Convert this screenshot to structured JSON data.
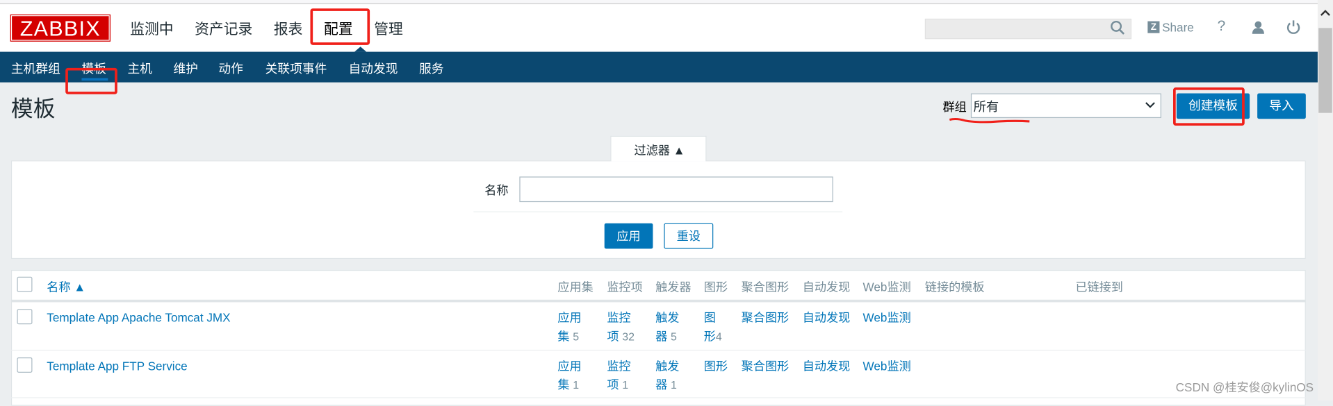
{
  "header": {
    "logo": "ZABBIX",
    "nav": [
      "监测中",
      "资产记录",
      "报表",
      "配置",
      "管理"
    ],
    "share": "Share",
    "help": "?"
  },
  "subnav": [
    "主机群组",
    "模板",
    "主机",
    "维护",
    "动作",
    "关联项事件",
    "自动发现",
    "服务"
  ],
  "page": {
    "title": "模板",
    "group_label": "群组",
    "group_value": "所有",
    "create_button": "创建模板",
    "import_button": "导入"
  },
  "filter": {
    "tab": "过滤器 ▲",
    "name_label": "名称",
    "name_value": "",
    "apply": "应用",
    "reset": "重设"
  },
  "table": {
    "headers": {
      "name": "名称 ▲",
      "apps": "应用集",
      "items": "监控项",
      "triggers": "触发器",
      "graphs": "图形",
      "screens": "聚合图形",
      "discovery": "自动发现",
      "web": "Web监测",
      "linked_templates": "链接的模板",
      "linked_to": "已链接到"
    },
    "rows": [
      {
        "name": "Template App Apache Tomcat JMX",
        "apps_a": "应用",
        "apps_b": "集",
        "apps_n": "5",
        "items_a": "监控",
        "items_b": "项",
        "items_n": "32",
        "triggers_a": "触发",
        "triggers_b": "器",
        "triggers_n": "5",
        "graphs_a": "图",
        "graphs_b": "形",
        "graphs_n": "4",
        "screens": "聚合图形",
        "discovery": "自动发现",
        "web": "Web监测"
      },
      {
        "name": "Template App FTP Service",
        "apps_a": "应用",
        "apps_b": "集",
        "apps_n": "1",
        "items_a": "监控",
        "items_b": "项",
        "items_n": "1",
        "triggers_a": "触发",
        "triggers_b": "器",
        "triggers_n": "1",
        "graphs_a": "图形",
        "graphs_b": "",
        "graphs_n": "",
        "screens": "聚合图形",
        "discovery": "自动发现",
        "web": "Web监测"
      }
    ]
  },
  "watermark": "CSDN @桂安俊@kylinOS"
}
